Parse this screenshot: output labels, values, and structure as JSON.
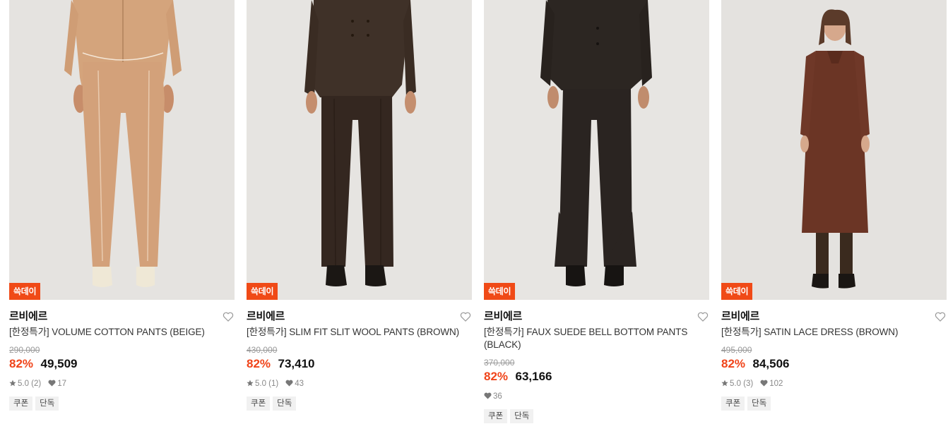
{
  "colors": {
    "sale_badge": "#f04a17",
    "discount_text": "#f0441a",
    "tag_bg": "#f1f1f1"
  },
  "products": [
    {
      "badge": "쓱데이",
      "brand": "르비에르",
      "name": "[한정특가] VOLUME COTTON PANTS (BEIGE)",
      "original_price": "290,000",
      "discount": "82%",
      "price": "49,509",
      "rating": "5.0 (2)",
      "likes": "17",
      "tags": [
        "쿠폰",
        "단독"
      ],
      "image": "model-in-beige-cotton-jacket-and-pants"
    },
    {
      "badge": "쓱데이",
      "brand": "르비에르",
      "name": "[한정특가] SLIM FIT SLIT WOOL PANTS (BROWN)",
      "original_price": "430,000",
      "discount": "82%",
      "price": "73,410",
      "rating": "5.0 (1)",
      "likes": "43",
      "tags": [
        "쿠폰",
        "단독"
      ],
      "image": "model-in-brown-wool-suit"
    },
    {
      "badge": "쓱데이",
      "brand": "르비에르",
      "name": "[한정특가] FAUX SUEDE BELL BOTTOM PANTS (BLACK)",
      "original_price": "370,000",
      "discount": "82%",
      "price": "63,166",
      "rating": "",
      "likes": "36",
      "tags": [
        "쿠폰",
        "단독"
      ],
      "image": "model-in-black-suede-jacket-and-bell-bottoms"
    },
    {
      "badge": "쓱데이",
      "brand": "르비에르",
      "name": "[한정특가] SATIN LACE DRESS (BROWN)",
      "original_price": "495,000",
      "discount": "82%",
      "price": "84,506",
      "rating": "5.0 (3)",
      "likes": "102",
      "tags": [
        "쿠폰",
        "단독"
      ],
      "image": "model-in-brown-lace-dress"
    }
  ]
}
